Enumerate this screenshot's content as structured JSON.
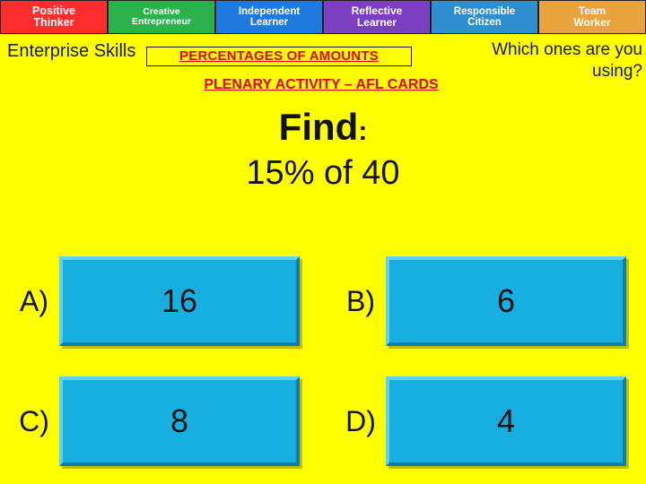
{
  "skills_bar": {
    "items": [
      {
        "label_line1": "Positive",
        "label_line2": "Thinker",
        "color": "#FF2D2D"
      },
      {
        "label_line1": "Creative",
        "label_line2": "Entrepreneur",
        "color": "#2BB24C"
      },
      {
        "label_line1": "Independent",
        "label_line2": "Learner",
        "color": "#1F7AE0"
      },
      {
        "label_line1": "Reflective",
        "label_line2": "Learner",
        "color": "#7D3FC1"
      },
      {
        "label_line1": "Responsible",
        "label_line2": "Citizen",
        "color": "#2F8FCE"
      },
      {
        "label_line1": "Team",
        "label_line2": "Worker",
        "color": "#E8A33D"
      }
    ]
  },
  "header": {
    "enterprise_skills": "Enterprise Skills",
    "percentages_title": "PERCENTAGES OF AMOUNTS",
    "plenary_title": "PLENARY ACTIVITY – AFL CARDS",
    "which_ones_line1": "Which ones are you",
    "which_ones_line2": "using?",
    "accent_color": "#E40000"
  },
  "question": {
    "find_label": "Find",
    "find_colon": ":",
    "prompt": "15% of 40"
  },
  "answers": [
    {
      "letter": "A)",
      "value": "16"
    },
    {
      "letter": "B)",
      "value": "6"
    },
    {
      "letter": "C)",
      "value": "8"
    },
    {
      "letter": "D)",
      "value": "4"
    }
  ],
  "theme": {
    "background": "#FFFF00",
    "answer_box": "#17AFE0"
  }
}
